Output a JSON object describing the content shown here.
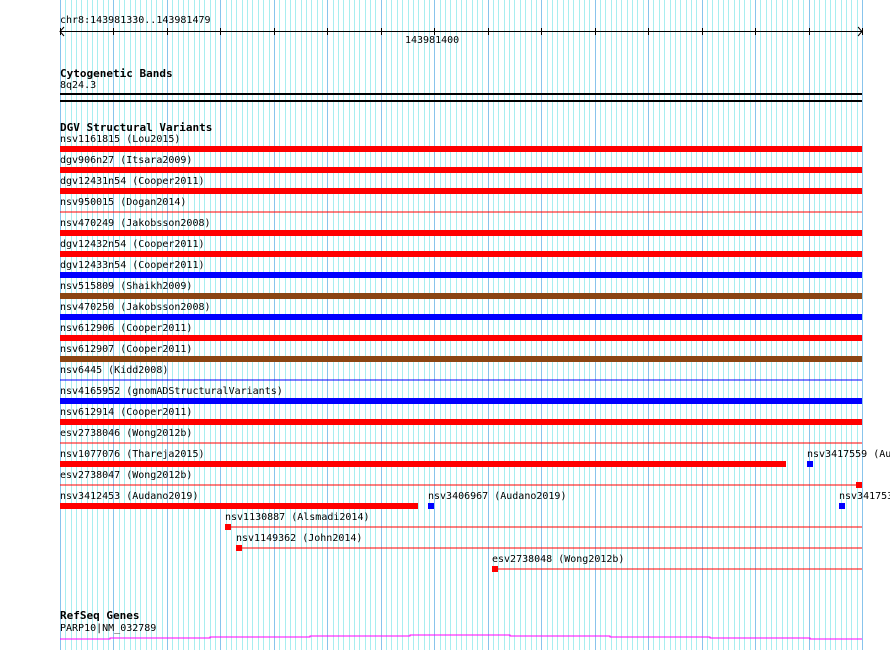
{
  "ruler": {
    "location": "chr8:143981330..143981479",
    "tick_label": "143981400"
  },
  "tracks": {
    "cyto": {
      "title": "Cytogenetic Bands",
      "band": "8q24.3"
    },
    "dgv": {
      "title": "DGV Structural Variants",
      "variants": [
        {
          "label": "nsv1161815 (Lou2015)",
          "color": "#ff0000",
          "style": "thick"
        },
        {
          "label": "dgv906n27 (Itsara2009)",
          "color": "#ff0000",
          "style": "thick"
        },
        {
          "label": "dgv12431n54 (Cooper2011)",
          "color": "#ff0000",
          "style": "thick"
        },
        {
          "label": "nsv950015 (Dogan2014)",
          "color": "#ff0000",
          "style": "thin"
        },
        {
          "label": "nsv470249 (Jakobsson2008)",
          "color": "#ff0000",
          "style": "thick"
        },
        {
          "label": "dgv12432n54 (Cooper2011)",
          "color": "#ff0000",
          "style": "thick"
        },
        {
          "label": "dgv12433n54 (Cooper2011)",
          "color": "#0000ff",
          "style": "thick"
        },
        {
          "label": "nsv515809 (Shaikh2009)",
          "color": "#8b4513",
          "style": "thick"
        },
        {
          "label": "nsv470250 (Jakobsson2008)",
          "color": "#0000ff",
          "style": "thick"
        },
        {
          "label": "nsv612906 (Cooper2011)",
          "color": "#ff0000",
          "style": "thick"
        },
        {
          "label": "nsv612907 (Cooper2011)",
          "color": "#8b4513",
          "style": "thick"
        },
        {
          "label": "nsv6445 (Kidd2008)",
          "color": "#0000ff",
          "style": "thin"
        },
        {
          "label": "nsv4165952 (gnomADStructuralVariants)",
          "color": "#0000ff",
          "style": "thick"
        },
        {
          "label": "nsv612914 (Cooper2011)",
          "color": "#ff0000",
          "style": "thick"
        },
        {
          "label": "esv2738046 (Wong2012b)",
          "color": "#ff0000",
          "style": "thin"
        },
        {
          "label": "nsv1077076 (Thareja2015)",
          "color": "#ff0000",
          "style": "thick"
        },
        {
          "label": "nsv3417559 (Au",
          "color": "#0000ff",
          "style": "box"
        },
        {
          "label": "esv2738047 (Wong2012b)",
          "color": "#ff0000",
          "style": "thin-box"
        },
        {
          "label": "nsv3412453 (Audano2019)",
          "color": "#ff0000",
          "style": "thick"
        },
        {
          "label": "nsv3406967 (Audano2019)",
          "color": "#0000ff",
          "style": "box"
        },
        {
          "label": "nsv341753",
          "color": "#0000ff",
          "style": "box"
        },
        {
          "label": "nsv1130887 (Alsmadi2014)",
          "color": "#ff0000",
          "style": "box-line"
        },
        {
          "label": "nsv1149362 (John2014)",
          "color": "#ff0000",
          "style": "box-line"
        },
        {
          "label": "esv2738048 (Wong2012b)",
          "color": "#ff0000",
          "style": "box-line"
        }
      ]
    },
    "refseq": {
      "title": "RefSeq Genes",
      "gene": "PARP10|NM_032789",
      "color": "#ff00ff"
    }
  },
  "colors": {
    "grid_minor": "#a8eef0",
    "grid_major": "#88c4ec"
  }
}
